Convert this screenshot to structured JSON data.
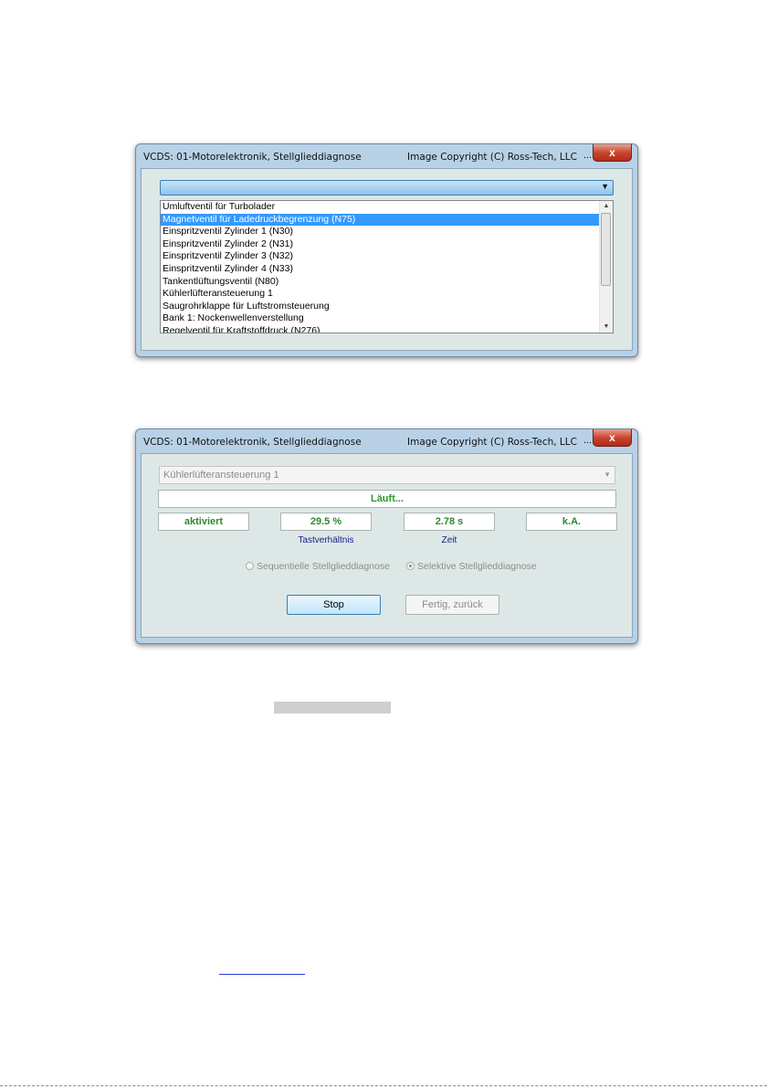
{
  "window1": {
    "title": "VCDS: 01-Motorelektronik,  Stellglieddiagnose",
    "copyright": "Image Copyright (C) Ross-Tech, LLC",
    "dots": "...",
    "close": "x",
    "list_items": [
      "Umluftventil für Turbolader",
      "Magnetventil für Ladedruckbegrenzung (N75)",
      "Einspritzventil Zylinder 1 (N30)",
      "Einspritzventil Zylinder 2 (N31)",
      "Einspritzventil Zylinder 3 (N32)",
      "Einspritzventil Zylinder 4 (N33)",
      "Tankentlüftungsventil (N80)",
      "Kühlerlüfteransteuerung 1",
      "Saugrohrklappe für Luftstromsteuerung",
      "Bank 1: Nockenwellenverstellung",
      "Regelventil für Kraftstoffdruck (N276)"
    ],
    "selected_index": 1
  },
  "window2": {
    "title": "VCDS: 01-Motorelektronik,  Stellglieddiagnose",
    "copyright": "Image Copyright (C) Ross-Tech, LLC",
    "dots": "...",
    "close": "x",
    "combo_value": "Kühlerlüfteransteuerung 1",
    "status": "Läuft...",
    "values": [
      "aktiviert",
      "29.5 %",
      "2.78 s",
      "k.A."
    ],
    "value_labels": [
      "",
      "Tastverhältnis",
      "Zeit",
      ""
    ],
    "radio_sequential": "Sequentielle Stellglieddiagnose",
    "radio_selective": "Selektive Stellglieddiagnose",
    "btn_stop": "Stop",
    "btn_done": "Fertig, zurück"
  },
  "colors": {
    "accent": "#3399ff",
    "value_green": "#2d8a2d",
    "label_blue": "#1a1a8a"
  }
}
